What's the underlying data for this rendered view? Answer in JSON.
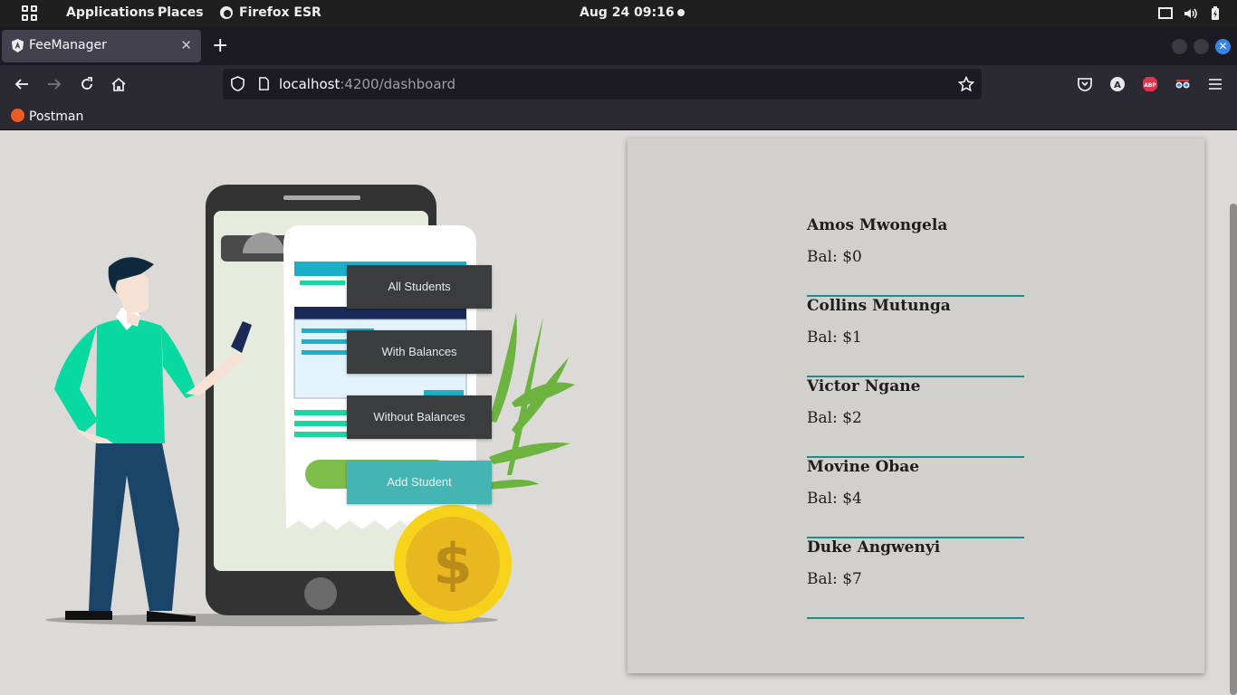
{
  "system": {
    "menu": [
      "Applications",
      "Places",
      "Firefox ESR"
    ],
    "clock": "Aug 24  09:16"
  },
  "browser": {
    "tab_title": "FeeManager",
    "url_host": "localhost",
    "url_rest": ":4200/dashboard",
    "bookmark": "Postman"
  },
  "actions": {
    "all_students": "All Students",
    "with_balances": "With Balances",
    "without_balances": "Without Balances",
    "add_student": "Add Student"
  },
  "students": [
    {
      "name": "Amos Mwongela",
      "balance": "Bal: $0"
    },
    {
      "name": "Collins Mutunga",
      "balance": "Bal: $1"
    },
    {
      "name": "Victor Ngane",
      "balance": "Bal: $2"
    },
    {
      "name": "Movine Obae",
      "balance": "Bal: $4"
    },
    {
      "name": "Duke Angwenyi",
      "balance": "Bal: $7"
    }
  ],
  "colors": {
    "accent": "#1f8c8a",
    "button_dark": "#3a3c3e",
    "button_teal": "#45b5b4"
  },
  "illustration": {
    "coin_symbol": "$"
  }
}
